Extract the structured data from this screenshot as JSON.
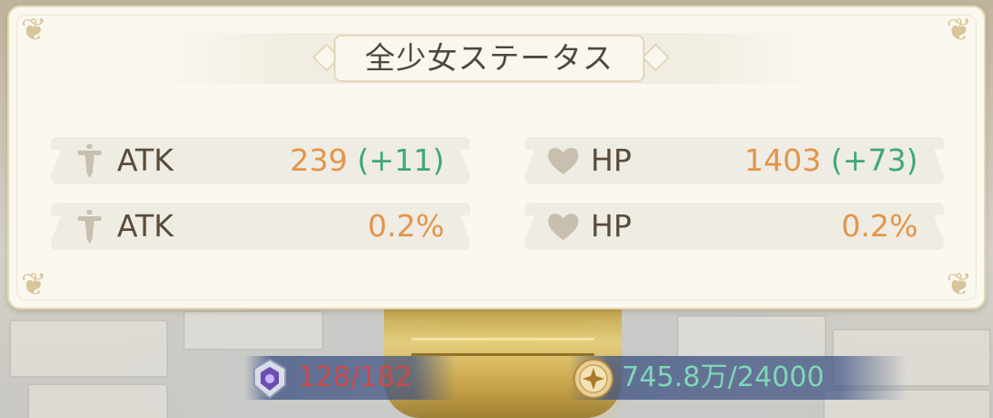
{
  "panel": {
    "title": "全少女ステータス"
  },
  "stats": [
    {
      "icon": "sword-icon",
      "label": "ATK",
      "value": "239",
      "bonus": "(+11)"
    },
    {
      "icon": "sword-icon",
      "label": "ATK",
      "value": "0.2%",
      "bonus": ""
    },
    {
      "icon": "heart-icon",
      "label": "HP",
      "value": "1403",
      "bonus": "(+73)"
    },
    {
      "icon": "heart-icon",
      "label": "HP",
      "value": "0.2%",
      "bonus": ""
    }
  ],
  "resources": [
    {
      "icon": "crest-icon",
      "value": "128/182",
      "color": "#c84a4a"
    },
    {
      "icon": "coin-icon",
      "value": "745.8万/24000",
      "color": "#7fd7b8"
    }
  ],
  "colors": {
    "value": "#e2954a",
    "bonus": "#3fa77c",
    "label": "#5a4c3c"
  }
}
